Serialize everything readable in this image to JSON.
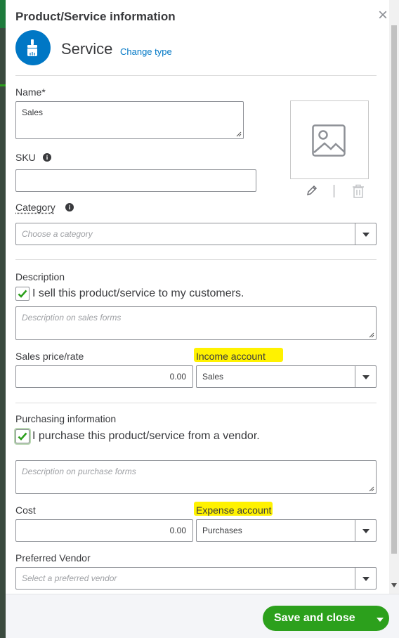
{
  "dialog": {
    "title": "Product/Service information",
    "close_glyph": "×",
    "type_icon": "paintbrush-icon",
    "type_label": "Service",
    "change_type_label": "Change type"
  },
  "name": {
    "label": "Name*",
    "value": "Sales"
  },
  "sku": {
    "label": "SKU",
    "value": "",
    "info_glyph": "i"
  },
  "category": {
    "label": "Category",
    "placeholder": "Choose a category",
    "info_glyph": "i"
  },
  "image": {
    "placeholder_icon": "image-placeholder-icon",
    "edit_icon": "pencil-icon",
    "delete_icon": "trash-icon"
  },
  "description": {
    "label": "Description",
    "checkbox_label": "I sell this product/service to my customers.",
    "checked": true,
    "placeholder": "Description on sales forms"
  },
  "sales_price": {
    "label": "Sales price/rate",
    "value": "0.00"
  },
  "income_account": {
    "label": "Income account",
    "value": "Sales",
    "highlighted": true
  },
  "purchasing": {
    "label": "Purchasing information",
    "checkbox_label": "I purchase this product/service from a vendor.",
    "checked": true,
    "placeholder": "Description on purchase forms"
  },
  "cost": {
    "label": "Cost",
    "value": "0.00"
  },
  "expense_account": {
    "label": "Expense account",
    "value": "Purchases",
    "highlighted": true
  },
  "preferred_vendor": {
    "label": "Preferred Vendor",
    "placeholder": "Select a preferred vendor"
  },
  "footer": {
    "save_label": "Save and close"
  },
  "colors": {
    "accent_blue": "#0077c5",
    "save_green": "#2ca01c",
    "highlight_yellow": "#fff200"
  }
}
